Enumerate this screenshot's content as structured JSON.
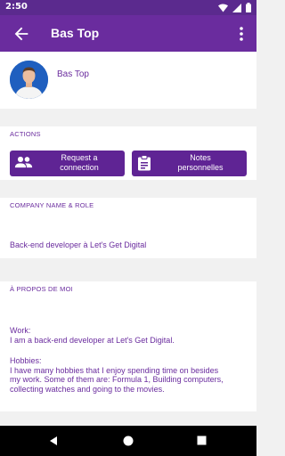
{
  "status": {
    "time": "2:50"
  },
  "appbar": {
    "title": "Bas Top"
  },
  "profile": {
    "name": "Bas Top"
  },
  "actions": {
    "heading": "ACTIONS",
    "request_line1": "Request a",
    "request_line2": "connection",
    "notes_line1": "Notes",
    "notes_line2": "personnelles"
  },
  "company": {
    "heading": "COMPANY NAME & ROLE",
    "value": "Back-end developer à Let's Get Digital"
  },
  "about": {
    "heading": "À PROPOS DE MOI",
    "work_label": "Work:",
    "work_text": "I am a back-end developer at Let's Get Digital.",
    "hobbies_label": "Hobbies:",
    "hobbies_line1": "I have many hobbies that I enjoy spending time on besides",
    "hobbies_line2": "my work. Some of them are: Formula 1, Building computers,",
    "hobbies_line3": "collecting watches and going to the movies."
  },
  "colors": {
    "primary": "#6a2c9e",
    "status": "#5b2a8e",
    "button": "#5f2494"
  }
}
